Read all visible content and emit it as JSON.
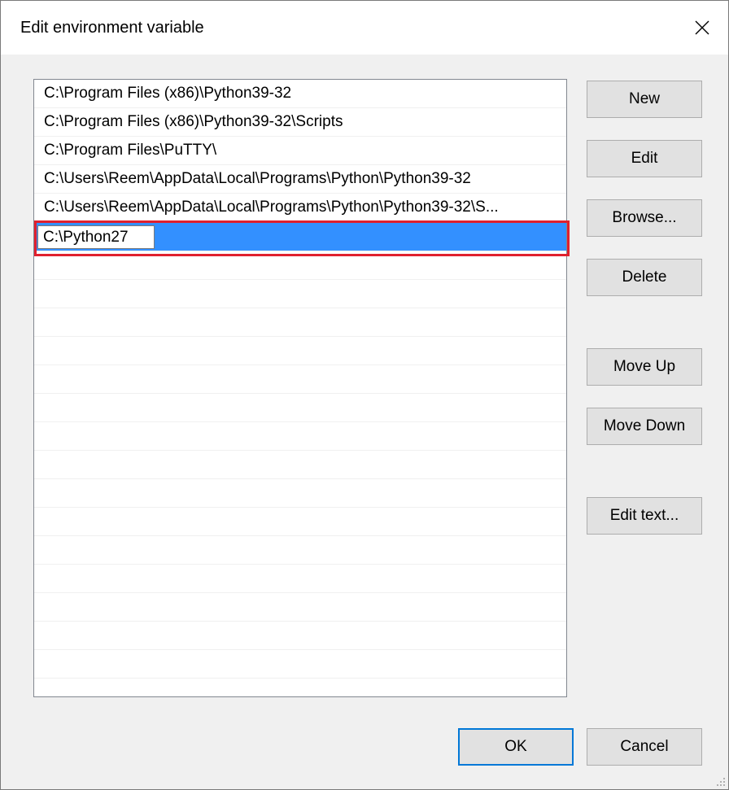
{
  "window": {
    "title": "Edit environment variable",
    "close_icon": "close-icon"
  },
  "list": {
    "items": [
      {
        "text": "C:\\Program Files (x86)\\Python39-32"
      },
      {
        "text": "C:\\Program Files (x86)\\Python39-32\\Scripts"
      },
      {
        "text": "C:\\Program Files\\PuTTY\\"
      },
      {
        "text": "C:\\Users\\Reem\\AppData\\Local\\Programs\\Python\\Python39-32"
      },
      {
        "text": "C:\\Users\\Reem\\AppData\\Local\\Programs\\Python\\Python39-32\\S..."
      }
    ],
    "editing_value": "C:\\Python27",
    "empty_row_count": 15
  },
  "buttons": {
    "new": "New",
    "edit": "Edit",
    "browse": "Browse...",
    "delete": "Delete",
    "move_up": "Move Up",
    "move_down": "Move Down",
    "edit_text": "Edit text...",
    "ok": "OK",
    "cancel": "Cancel"
  },
  "colors": {
    "selection": "#3390ff",
    "highlight_border": "#e0202e",
    "default_button_border": "#0078d7"
  }
}
